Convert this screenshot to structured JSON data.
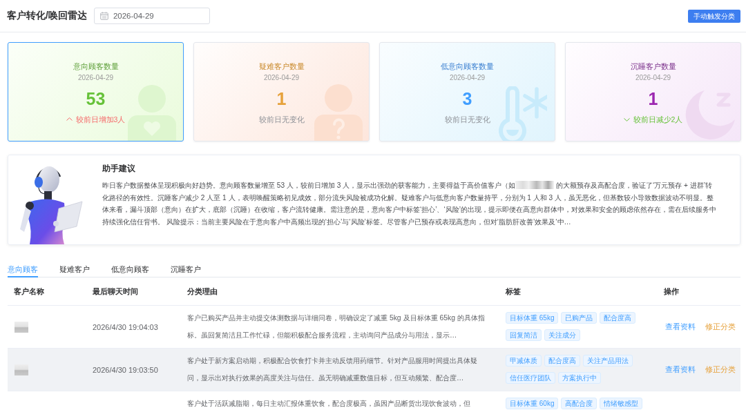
{
  "header": {
    "title": "客户转化/唤回雷达",
    "date": "2026-04-29",
    "button": "手动触发分类"
  },
  "cards": [
    {
      "kind": "intent",
      "title": "意向顾客数量",
      "date": "2026-04-29",
      "value": "53",
      "change": {
        "kind": "increase",
        "text": "较前日增加3人"
      },
      "selected": true
    },
    {
      "kind": "difficult",
      "title": "疑难客户数量",
      "date": "2026-04-29",
      "value": "1",
      "change": {
        "kind": "same",
        "text": "较前日无变化"
      },
      "selected": false
    },
    {
      "kind": "low",
      "title": "低意向顾客数量",
      "date": "2026-04-29",
      "value": "3",
      "change": {
        "kind": "same",
        "text": "较前日无变化"
      },
      "selected": false
    },
    {
      "kind": "dormant",
      "title": "沉睡客户数量",
      "date": "2026-04-29",
      "value": "1",
      "change": {
        "kind": "decrease",
        "text": "较前日减少2人"
      },
      "selected": false
    }
  ],
  "assistant": {
    "title": "助手建议",
    "text_parts": [
      "昨日客户数据整体呈现积极向好趋势。意向顾客数量增至 53 人，较前日增加 3 人，显示出强劲的获客能力，主要得益于高价值客户（如",
      " 的大额预存及高配合度，验证了‘万元预存 + 进群’转化路径的有效性。沉睡客户减少 2 人至 1 人，表明唤醒策略初见成效，部分流失风险被成功化解。疑难客户与低意向客户数量持平，分别为 1 人和 3 人，虽无恶化，但基数较小导致数据波动不明显。整体来看，漏斗顶部（意向）在扩大，底部（沉睡）在收缩，客户流转健康。需注意的是，意向客户中标签‘担心’、‘风险’的出现，提示即便在高意向群体中，对效果和安全的顾虑依然存在，需在后续服务中持续强化信任背书。 风险提示：当前主要风险在于意向客户中高频出现的‘担心’与‘风险’标签。尽管客户已预存或表现高意向，但对‘脂肪肝改善’效果及‘中…"
    ]
  },
  "tabs": [
    {
      "label": "意向顾客",
      "selected": true
    },
    {
      "label": "疑难客户",
      "selected": false
    },
    {
      "label": "低意向顾客",
      "selected": false
    },
    {
      "label": "沉睡客户",
      "selected": false
    }
  ],
  "table": {
    "columns": [
      "客户名称",
      "最后聊天时间",
      "分类理由",
      "标签",
      "操作"
    ],
    "rows": [
      {
        "name_blurred": true,
        "highlighted": false,
        "last_chat": "2026/4/30 19:04:03",
        "reason": "客户已购买产品并主动提交体测数据与详细问卷，明确设定了减重 5kg 及目标体重 65kg 的具体指标。虽回复简洁且工作忙碌，但能积极配合服务流程，主动询问产品成分与用法，显示…",
        "tags": [
          "目标体重 65kg",
          "已购产品",
          "配合度高",
          "回复简洁",
          "关注成分"
        ],
        "actions": [
          {
            "kind": "view",
            "label": "查看资料"
          },
          {
            "kind": "reclassify",
            "label": "修正分类"
          }
        ]
      },
      {
        "name_blurred": true,
        "highlighted": true,
        "last_chat": "2026/4/30 19:03:50",
        "reason": "客户处于新方案启动期，积极配合饮食打卡并主动反馈用药细节。针对产品服用时间提出具体疑问，显示出对执行效果的高度关注与信任。虽无明确减重数值目标，但互动频繁、配合度…",
        "tags": [
          "甲减体质",
          "配合度高",
          "关注产品用法",
          "信任医疗团队",
          "方案执行中"
        ],
        "actions": [
          {
            "kind": "view",
            "label": "查看资料"
          },
          {
            "kind": "reclassify",
            "label": "修正分类"
          }
        ]
      },
      {
        "name_blurred": false,
        "highlighted": false,
        "reason": "客户处于活跃减脂期，每日主动汇报体重饮食，配合度极高，虽因产品断货出现饮食波动，但",
        "tags": [
          "目标体重 60kg",
          "高配合度",
          "情绪敏感型"
        ]
      }
    ]
  }
}
